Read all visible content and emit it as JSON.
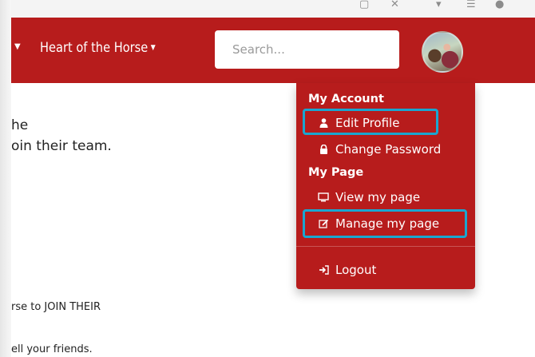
{
  "navbar": {
    "dropdown_label": "Heart of the Horse",
    "search_placeholder": "Search..."
  },
  "content": {
    "line1": "he",
    "line2": "oin their team.",
    "line3": "rse to JOIN THEIR",
    "line4": "ell your friends."
  },
  "menu": {
    "section_account": "My Account",
    "edit_profile": "Edit Profile",
    "change_password": "Change Password",
    "section_page": "My Page",
    "view_page": "View my page",
    "manage_page": "Manage my page",
    "logout": "Logout"
  },
  "colors": {
    "brand_red": "#b71c1c",
    "highlight_blue": "#1aa6d0"
  },
  "icons": [
    "user-icon",
    "lock-icon",
    "monitor-icon",
    "edit-icon",
    "logout-icon"
  ]
}
